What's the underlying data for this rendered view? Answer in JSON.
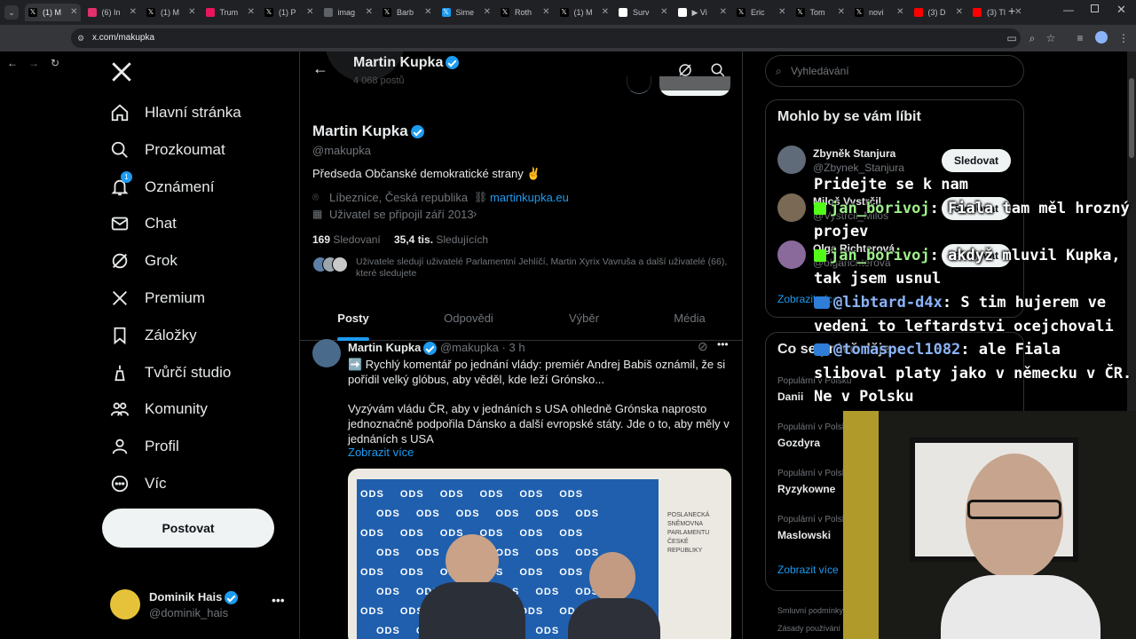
{
  "browser": {
    "tabs": [
      {
        "label": "(1) M",
        "favicon": "x",
        "color": "#000000",
        "active": true
      },
      {
        "label": "(6) In",
        "favicon": "instagram",
        "color": "#e1306c"
      },
      {
        "label": "(1) M",
        "favicon": "x",
        "color": "#000000"
      },
      {
        "label": "Trum",
        "favicon": "in",
        "color": "#e8175d"
      },
      {
        "label": "(1) P",
        "favicon": "x",
        "color": "#000000"
      },
      {
        "label": "imag",
        "favicon": "globe",
        "color": "#5f6368"
      },
      {
        "label": "Barb",
        "favicon": "x",
        "color": "#000000"
      },
      {
        "label": "Sime",
        "favicon": "x",
        "color": "#1d9bf0"
      },
      {
        "label": "Roth",
        "favicon": "x",
        "color": "#000000"
      },
      {
        "label": "(1) M",
        "favicon": "x",
        "color": "#000000"
      },
      {
        "label": "Surv",
        "favicon": "compass",
        "color": "#ffffff"
      },
      {
        "label": "▶ Vi",
        "favicon": "cam",
        "color": "#ffffff"
      },
      {
        "label": "Eric",
        "favicon": "x",
        "color": "#000000"
      },
      {
        "label": "Tom",
        "favicon": "x",
        "color": "#000000"
      },
      {
        "label": "novi",
        "favicon": "x",
        "color": "#000000"
      },
      {
        "label": "(3) D",
        "favicon": "youtube",
        "color": "#ff0000"
      },
      {
        "label": "(3) Tl",
        "favicon": "youtube",
        "color": "#ff0000"
      }
    ],
    "url": "x.com/makupka"
  },
  "nav": {
    "items": [
      {
        "label": "Hlavní stránka",
        "icon": "home-icon"
      },
      {
        "label": "Prozkoumat",
        "icon": "search-icon"
      },
      {
        "label": "Oznámení",
        "icon": "bell-icon",
        "badge": "1"
      },
      {
        "label": "Chat",
        "icon": "mail-icon"
      },
      {
        "label": "Grok",
        "icon": "grok-icon"
      },
      {
        "label": "Premium",
        "icon": "x-icon"
      },
      {
        "label": "Záložky",
        "icon": "bookmark-icon"
      },
      {
        "label": "Tvůrčí studio",
        "icon": "studio-icon"
      },
      {
        "label": "Komunity",
        "icon": "people-icon"
      },
      {
        "label": "Profil",
        "icon": "person-icon"
      },
      {
        "label": "Víc",
        "icon": "more-icon"
      }
    ],
    "post_label": "Postovat",
    "account": {
      "name": "Dominik Hais",
      "handle": "@dominik_hais"
    }
  },
  "profile": {
    "header_name": "Martin Kupka",
    "header_posts": "4 068 postů",
    "name": "Martin Kupka",
    "handle": "@makupka",
    "bio": "Předseda Občanské demokratické strany ✌",
    "location": "Líbeznice, Česká republika",
    "website": "martinkupka.eu",
    "joined": "Uživatel se připojil září 2013",
    "following_count": "169",
    "following_label": "Sledovaní",
    "followers_count": "35,4 tis.",
    "followers_label": "Sledujících",
    "followed_by": "Uživatele sledují uživatelé Parlamentní Jehlíčí, Martin Xyrix Vavruša a další uživatelé (66), které sledujete",
    "tabs": [
      "Posty",
      "Odpovědi",
      "Výběr",
      "Média"
    ]
  },
  "post": {
    "author": "Martin Kupka",
    "handle": "@makupka",
    "time": "3 h",
    "line1": "➡️ Rychlý komentář po jednání vlády: premiér Andrej Babiš oznámil, že si pořídil velký glóbus, aby věděl, kde leží Grónsko...",
    "line2": "Vyzývám vládu ČR, aby v jednáních s USA ohledně Grónska naprosto jednoznačně podpořila Dánsko a další evropské státy. Jde o to, aby měly v jednáních s USA",
    "more": "Zobrazit více",
    "image_text_ods": "ODS",
    "image_sign": "POSLANECKÁ SNĚMOVNA PARLAMENTU ČESKÉ REPUBLIKY"
  },
  "sidebar": {
    "search_placeholder": "Vyhledávání",
    "suggest_title": "Mohlo by se vám líbit",
    "suggestions": [
      {
        "name": "Zbyněk Stanjura",
        "handle": "@Zbynek_Stanjura",
        "button": "Sledovat"
      },
      {
        "name": "Miloš Vystrčil",
        "handle": "@Vystrcil_Milos",
        "button": "Sledovat"
      },
      {
        "name": "Olga Richterová",
        "handle": "@olgarichterova",
        "button": "Sledovat"
      }
    ],
    "suggest_more": "Zobrazit více",
    "trends_title": "Co se právě děje",
    "trends": [
      {
        "sub": "Populární v Polsku",
        "name": "Danii"
      },
      {
        "sub": "Populární v Polsku",
        "name": "Gozdyra"
      },
      {
        "sub": "Populární v Polsku",
        "name": "Ryzykowne"
      },
      {
        "sub": "Populární v Polsku",
        "name": "Maslowski"
      }
    ],
    "trends_more": "Zobrazit více",
    "footer1": "Smluvní podmínky",
    "footer2": "Zásady používání"
  },
  "chat": [
    {
      "text": "Pridejte se k nam"
    },
    {
      "user": "jan_borivoj",
      "platform": "kick",
      "text": "Fiala tam měl hrozný"
    },
    {
      "text": "projev"
    },
    {
      "user": "jan_borivoj",
      "platform": "kick",
      "text": "akdyž mluvil Kupka,"
    },
    {
      "text": "tak jsem usnul"
    },
    {
      "user": "@libtard-d4x",
      "platform": "youtube",
      "text": "S tim hujerem ve"
    },
    {
      "text": "vedeni to leftardstvi ocejchovali"
    },
    {
      "user": "@tomaspecl1082",
      "platform": "youtube",
      "text": "ale Fiala"
    },
    {
      "text": "sliboval platy jako v německu v ČR."
    },
    {
      "text": "Ne v Polsku"
    }
  ]
}
